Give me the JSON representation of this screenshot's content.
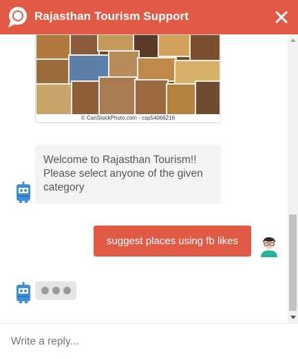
{
  "header": {
    "title": "Rajasthan Tourism Support",
    "logo_icon": "chat-bubble-icon",
    "close_icon": "close-icon",
    "background": "#e05a45"
  },
  "messages": {
    "image_caption": "© CanStockPhoto.com - csp54066216",
    "bot_welcome": "Welcome to Rajasthan Tourism!! Please select anyone of the given category",
    "user_message": "suggest places using fb likes",
    "typing_indicator": "typing-dots"
  },
  "reply": {
    "placeholder": "Write a reply..."
  },
  "colors": {
    "accent": "#e05a45",
    "bot_bubble": "#f3f3f3",
    "bot_avatar": "#3f8fd6"
  }
}
